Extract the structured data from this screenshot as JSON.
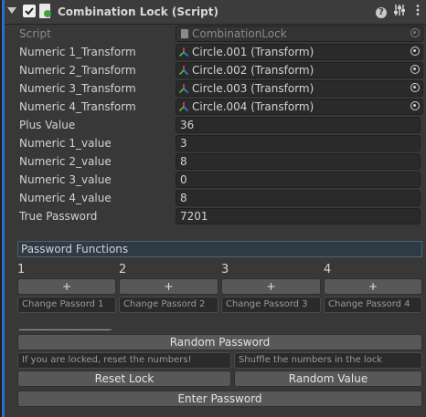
{
  "component": {
    "title": "Combination Lock (Script)"
  },
  "fields": {
    "script": {
      "label": "Script",
      "value": "CombinationLock"
    },
    "transforms": [
      {
        "label": "Numeric 1_Transform",
        "value": "Circle.001 (Transform)"
      },
      {
        "label": "Numeric 2_Transform",
        "value": "Circle.002 (Transform)"
      },
      {
        "label": "Numeric 3_Transform",
        "value": "Circle.003 (Transform)"
      },
      {
        "label": "Numeric 4_Transform",
        "value": "Circle.004 (Transform)"
      }
    ],
    "values": [
      {
        "label": "Plus Value",
        "value": "36"
      },
      {
        "label": "Numeric 1_value",
        "value": "3"
      },
      {
        "label": "Numeric 2_value",
        "value": "8"
      },
      {
        "label": "Numeric 3_value",
        "value": "0"
      },
      {
        "label": "Numeric 4_value",
        "value": "8"
      },
      {
        "label": "True Password",
        "value": "7201"
      }
    ]
  },
  "password_functions": {
    "header": "Password Functions",
    "columns": [
      {
        "number": "1",
        "plus_label": "+",
        "change_label": "Change Passord 1"
      },
      {
        "number": "2",
        "plus_label": "+",
        "change_label": "Change Passord 2"
      },
      {
        "number": "3",
        "plus_label": "+",
        "change_label": "Change Passord 3"
      },
      {
        "number": "4",
        "plus_label": "+",
        "change_label": "Change Passord 4"
      }
    ],
    "separator": "____________________",
    "random_password_label": "Random Password",
    "reset_hint": "If you are locked, reset the numbers!",
    "shuffle_hint": "Shuffle the numbers in the lock",
    "reset_lock_label": "Reset Lock",
    "random_value_label": "Random Value",
    "enter_password_label": "Enter Password"
  },
  "colors": {
    "accent_bar": "#2d6cc7",
    "panel_bg": "#383838",
    "field_bg": "#2a2a2a",
    "button_bg": "#585858",
    "section_header_bg": "#2e3a46",
    "transform_icon": [
      "#e04a3c",
      "#52b84a",
      "#3d7ee0"
    ]
  },
  "icons": {
    "foldout": "triangle-down-icon",
    "enabled": "checkbox-checked-icon",
    "script": "script-icon",
    "help": "help-icon",
    "presets": "presets-icon",
    "menu": "kebab-menu-icon",
    "transform": "transform-icon",
    "object_picker": "object-picker-icon"
  }
}
